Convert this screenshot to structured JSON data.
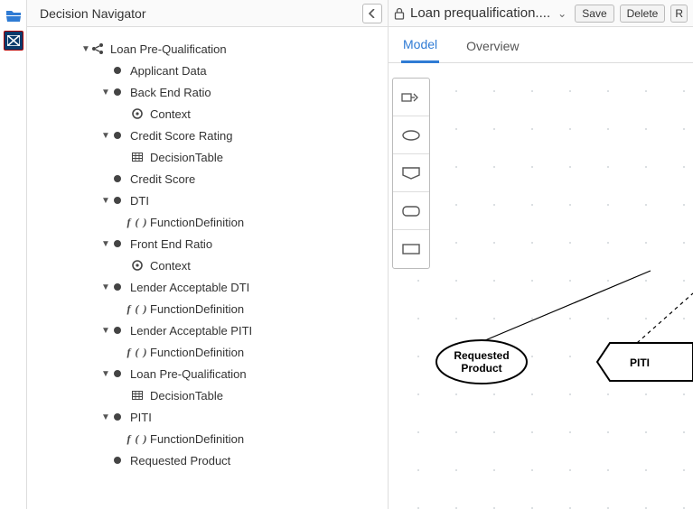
{
  "nav": {
    "title": "Decision Navigator",
    "tree": {
      "root": {
        "label": "Loan Pre-Qualification",
        "children": [
          {
            "label": "Applicant Data",
            "kind": "circle"
          },
          {
            "label": "Back End Ratio",
            "kind": "circle",
            "sub": {
              "label": "Context",
              "kind": "context"
            }
          },
          {
            "label": "Credit Score Rating",
            "kind": "circle",
            "sub": {
              "label": "DecisionTable",
              "kind": "table"
            }
          },
          {
            "label": "Credit Score",
            "kind": "circle"
          },
          {
            "label": "DTI",
            "kind": "circle",
            "sub": {
              "label": "FunctionDefinition",
              "kind": "fn"
            }
          },
          {
            "label": "Front End Ratio",
            "kind": "circle",
            "sub": {
              "label": "Context",
              "kind": "context"
            }
          },
          {
            "label": "Lender Acceptable DTI",
            "kind": "circle",
            "sub": {
              "label": "FunctionDefinition",
              "kind": "fn"
            }
          },
          {
            "label": "Lender Acceptable PITI",
            "kind": "circle",
            "sub": {
              "label": "FunctionDefinition",
              "kind": "fn"
            }
          },
          {
            "label": "Loan Pre-Qualification",
            "kind": "circle",
            "sub": {
              "label": "DecisionTable",
              "kind": "table"
            }
          },
          {
            "label": "PITI",
            "kind": "circle",
            "sub": {
              "label": "FunctionDefinition",
              "kind": "fn"
            }
          },
          {
            "label": "Requested Product",
            "kind": "circle"
          }
        ]
      }
    }
  },
  "header": {
    "lock_icon": "lock-icon",
    "title": "Loan prequalification....",
    "buttons": {
      "save": "Save",
      "delete": "Delete",
      "more": "R"
    }
  },
  "tabs": {
    "model": "Model",
    "overview": "Overview",
    "active": "model"
  },
  "palette": {
    "items": [
      "dmn-diagram-icon",
      "oval-shape-icon",
      "flag-shape-icon",
      "rounded-rect-shape-icon",
      "rect-shape-icon"
    ]
  },
  "diagram": {
    "nodes": {
      "requested_product": {
        "label1": "Requested",
        "label2": "Product"
      },
      "piti": {
        "label1": "PITI"
      }
    }
  }
}
